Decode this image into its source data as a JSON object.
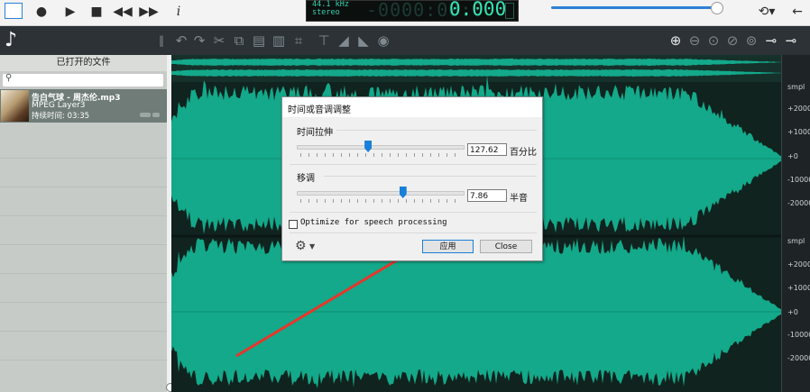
{
  "topbar": {
    "icons": [
      "select-icon",
      "record-icon",
      "play-icon",
      "stop-icon",
      "rewind-icon",
      "fast-forward-icon",
      "info-icon"
    ],
    "lcd": {
      "sample_rate": "44.1 kHz",
      "channels": "stereo",
      "time_dim": "-0000:00:0",
      "time": "0.000"
    },
    "volume": 0.96
  },
  "toolbar": {
    "icons": [
      "undo-icon",
      "redo-icon",
      "cut-icon",
      "copy-icon",
      "paste-icon",
      "delete-icon",
      "crop-icon",
      "fade-in-icon",
      "fade-out-icon",
      "normalize-icon",
      "effect-icon",
      "zoom-in-icon",
      "zoom-out-icon",
      "zoom-selection-icon",
      "zoom-fit-icon",
      "zoom-full-icon",
      "tool-a-icon",
      "tool-b-icon"
    ]
  },
  "sidebar": {
    "title": "已打开的文件",
    "search_placeholder": "",
    "file": {
      "name": "告白气球 - 周杰伦.mp3",
      "format": "MPEG Layer3",
      "duration": "持续时间: 03:35"
    }
  },
  "ruler": {
    "top": [
      "smpl",
      "+2000",
      "+1000",
      "+0",
      "-10000",
      "-20000"
    ],
    "bottom": [
      "smpl",
      "+2000",
      "+1000",
      "+0",
      "-10000",
      "-20000"
    ]
  },
  "dialog": {
    "title": "时间或音调调整",
    "stretch": {
      "label": "时间拉伸",
      "value": "127.62",
      "unit": "百分比",
      "level": 0.43
    },
    "pitch": {
      "label": "移调",
      "value": "7.86",
      "unit": "半音",
      "level": 0.64
    },
    "optimize_label": "Optimize for speech processing",
    "optimize_checked": false,
    "apply_label": "应用",
    "close_label": "Close"
  },
  "colors": {
    "wave": "#13a98a",
    "wave_bg": "#10231e",
    "annotation_arrow": "#e8362a",
    "accent": "#1a7fd9"
  }
}
